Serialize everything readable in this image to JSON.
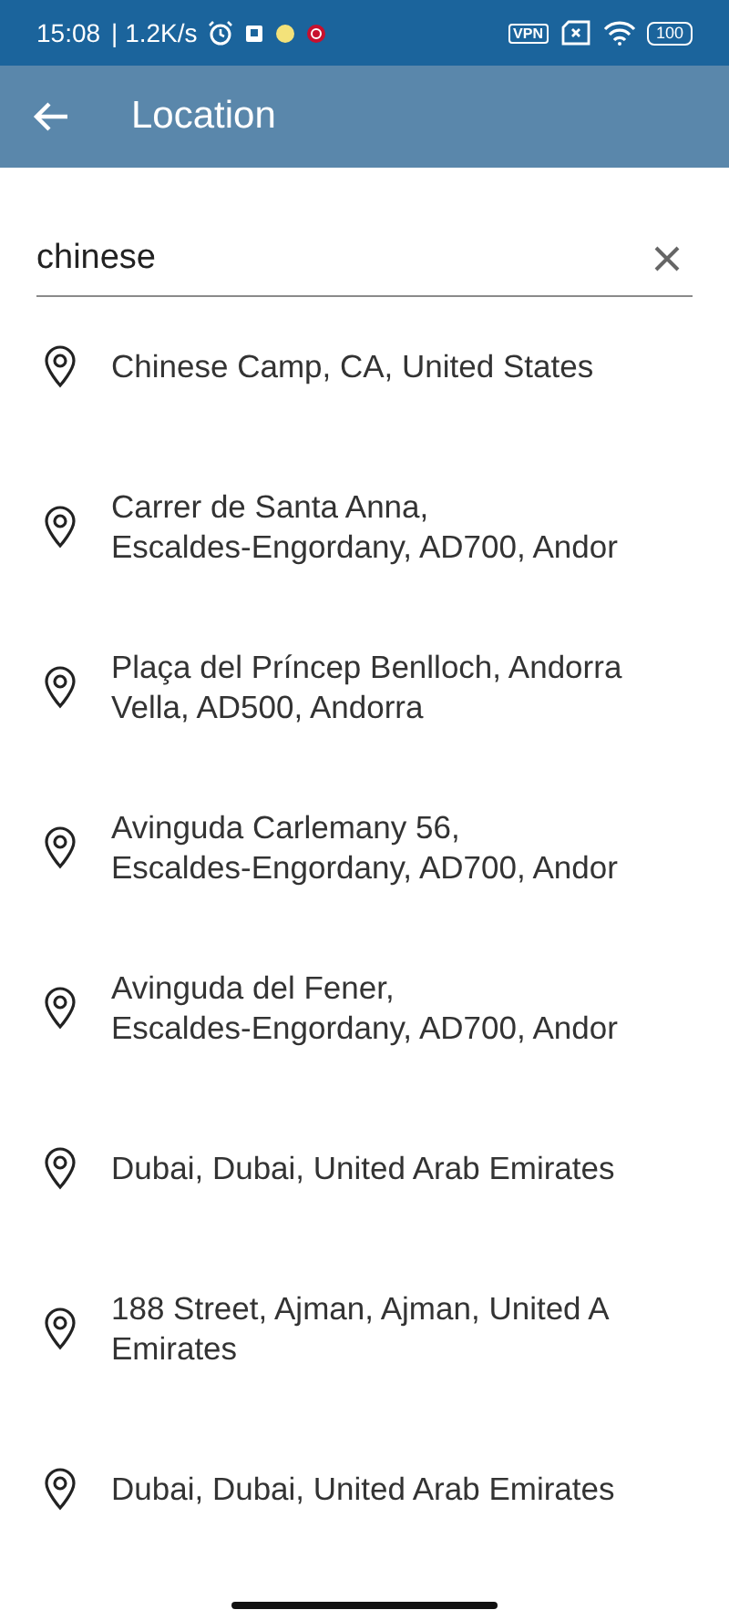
{
  "status_bar": {
    "time": "15:08",
    "speed": "| 1.2K/s",
    "vpn": "VPN",
    "battery": "100"
  },
  "app_bar": {
    "title": "Location"
  },
  "search": {
    "value": "chinese"
  },
  "results": [
    {
      "lines": [
        "Chinese Camp, CA, United States"
      ]
    },
    {
      "lines": [
        "Carrer de Santa Anna,",
        "Escaldes-Engordany, AD700, Andor"
      ]
    },
    {
      "lines": [
        "Plaça del Príncep Benlloch, Andorra",
        "Vella, AD500, Andorra"
      ]
    },
    {
      "lines": [
        "Avinguda Carlemany 56,",
        "Escaldes-Engordany, AD700, Andor"
      ]
    },
    {
      "lines": [
        "Avinguda del Fener,",
        "Escaldes-Engordany, AD700, Andor"
      ]
    },
    {
      "lines": [
        "Dubai, Dubai, United Arab Emirates"
      ]
    },
    {
      "lines": [
        "188 Street, Ajman, Ajman, United A",
        "Emirates"
      ]
    },
    {
      "lines": [
        "Dubai, Dubai, United Arab Emirates"
      ]
    }
  ]
}
